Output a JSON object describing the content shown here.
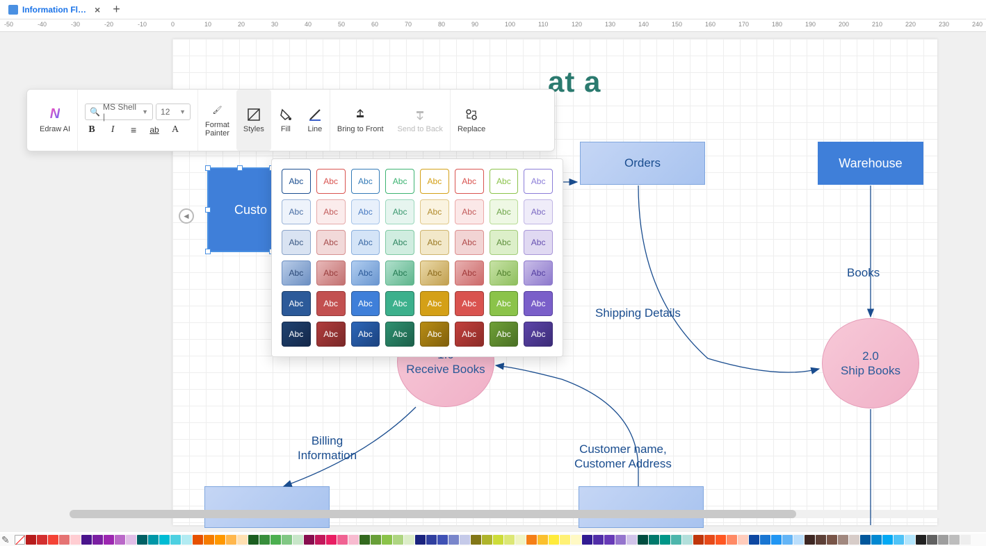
{
  "tab": {
    "title": "Information Fl…"
  },
  "ruler_ticks": [
    -50,
    -40,
    -30,
    -20,
    -10,
    0,
    10,
    20,
    30,
    40,
    50,
    60,
    70,
    80,
    90,
    100,
    110,
    120,
    130,
    140,
    150,
    160,
    170,
    180,
    190,
    200,
    210,
    220,
    230,
    240
  ],
  "toolbar": {
    "ai_label": "Edraw AI",
    "font_name": "MS Shell |",
    "font_size": "12",
    "format_painter": "Format\nPainter",
    "styles": "Styles",
    "fill": "Fill",
    "line": "Line",
    "bring_front": "Bring to Front",
    "send_back": "Send to Back",
    "replace": "Replace"
  },
  "style_swatches": [
    {
      "bg": "#ffffff",
      "bd": "#1a4d8f",
      "fg": "#1a4d8f"
    },
    {
      "bg": "#ffffff",
      "bd": "#d9534f",
      "fg": "#d9534f"
    },
    {
      "bg": "#ffffff",
      "bd": "#337ab7",
      "fg": "#337ab7"
    },
    {
      "bg": "#ffffff",
      "bd": "#3cb371",
      "fg": "#3cb371"
    },
    {
      "bg": "#ffffff",
      "bd": "#d4a017",
      "fg": "#d4a017"
    },
    {
      "bg": "#ffffff",
      "bd": "#d9534f",
      "fg": "#d9534f"
    },
    {
      "bg": "#ffffff",
      "bd": "#8bc34a",
      "fg": "#8bc34a"
    },
    {
      "bg": "#ffffff",
      "bd": "#8b7dd8",
      "fg": "#8b7dd8"
    },
    {
      "bg": "#eef3fb",
      "bd": "#9ab4d8",
      "fg": "#4a6fa5"
    },
    {
      "bg": "#fbecec",
      "bd": "#e5a9a9",
      "fg": "#c25b5b"
    },
    {
      "bg": "#e8f0fb",
      "bd": "#a5c3e8",
      "fg": "#4a7bc2"
    },
    {
      "bg": "#e6f5ef",
      "bd": "#9bd8bc",
      "fg": "#3c9970"
    },
    {
      "bg": "#faf3e0",
      "bd": "#e0c88a",
      "fg": "#b28c2e"
    },
    {
      "bg": "#fbe8e8",
      "bd": "#eba8a8",
      "fg": "#c25b5b"
    },
    {
      "bg": "#eef8e4",
      "bd": "#b8dc96",
      "fg": "#6fa54a"
    },
    {
      "bg": "#efecf9",
      "bd": "#c0b5e5",
      "fg": "#7a68c2"
    },
    {
      "bg": "#d9e3f2",
      "bd": "#8ba4c9",
      "fg": "#3c5a85"
    },
    {
      "bg": "#f2d9d9",
      "bd": "#d69090",
      "fg": "#a54a4a"
    },
    {
      "bg": "#d4e4f7",
      "bd": "#8cb0dd",
      "fg": "#3c6aa5"
    },
    {
      "bg": "#d0ede0",
      "bd": "#7fc9a3",
      "fg": "#2e8560"
    },
    {
      "bg": "#f2e8c9",
      "bd": "#cfb46e",
      "fg": "#9b7a25"
    },
    {
      "bg": "#f2d4d4",
      "bd": "#dc8f8f",
      "fg": "#b04a4a"
    },
    {
      "bg": "#dcefc9",
      "bd": "#a3cc7a",
      "fg": "#5e8f3c"
    },
    {
      "bg": "#e0d9f2",
      "bd": "#a896d8",
      "fg": "#6650b0"
    },
    {
      "bg": "#b8cce8",
      "bd": "#6c8fc2",
      "fg": "#2c4a78",
      "grad": true
    },
    {
      "bg": "#e8b8b8",
      "bd": "#c27070",
      "fg": "#993c3c",
      "grad": true
    },
    {
      "bg": "#b0cdf0",
      "bd": "#6a96d0",
      "fg": "#2c5a99",
      "grad": true
    },
    {
      "bg": "#b0e0cc",
      "bd": "#5eb58c",
      "fg": "#237a52",
      "grad": true
    },
    {
      "bg": "#ead9a8",
      "bd": "#c2a050",
      "fg": "#8c6a1c",
      "grad": true
    },
    {
      "bg": "#e8b0b0",
      "bd": "#cc6a6a",
      "fg": "#a03838",
      "grad": true
    },
    {
      "bg": "#c7e2a6",
      "bd": "#8fbf5e",
      "fg": "#4f7f2c",
      "grad": true
    },
    {
      "bg": "#c9bde8",
      "bd": "#8c78cc",
      "fg": "#523ca0",
      "grad": true
    },
    {
      "bg": "#2c5a99",
      "bd": "#1c3c66",
      "fg": "#ffffff"
    },
    {
      "bg": "#c25050",
      "bd": "#993838",
      "fg": "#ffffff"
    },
    {
      "bg": "#3f7fd9",
      "bd": "#2c5a99",
      "fg": "#ffffff"
    },
    {
      "bg": "#3cb08c",
      "bd": "#287a60",
      "fg": "#ffffff"
    },
    {
      "bg": "#d4a017",
      "bd": "#a07810",
      "fg": "#ffffff"
    },
    {
      "bg": "#d9534f",
      "bd": "#a03c38",
      "fg": "#ffffff"
    },
    {
      "bg": "#8bc34a",
      "bd": "#5e9030",
      "fg": "#ffffff"
    },
    {
      "bg": "#7a5fc9",
      "bd": "#5640a0",
      "fg": "#ffffff"
    },
    {
      "bg": "#1f4270",
      "bd": "#14284a",
      "fg": "#ffffff",
      "grad": true
    },
    {
      "bg": "#b03c3c",
      "bd": "#7a2828",
      "fg": "#ffffff",
      "grad": true
    },
    {
      "bg": "#2c66b8",
      "bd": "#1c4380",
      "fg": "#ffffff",
      "grad": true
    },
    {
      "bg": "#2e9070",
      "bd": "#1c604a",
      "fg": "#ffffff",
      "grad": true
    },
    {
      "bg": "#b88c14",
      "bd": "#80600c",
      "fg": "#ffffff",
      "grad": true
    },
    {
      "bg": "#c2403c",
      "bd": "#8c2c28",
      "fg": "#ffffff",
      "grad": true
    },
    {
      "bg": "#6fa038",
      "bd": "#4a7024",
      "fg": "#ffffff",
      "grad": true
    },
    {
      "bg": "#5c44a8",
      "bd": "#3c2c78",
      "fg": "#ffffff",
      "grad": true
    }
  ],
  "swatch_label": "Abc",
  "diagram": {
    "title_fragment": "at a",
    "title_color": "#2b7a6f",
    "customer": "Custo",
    "orders": "Orders",
    "warehouse": "Warehouse",
    "process1_num": "1.0",
    "process1": "Receive Books",
    "process2_num": "2.0",
    "process2": "Ship Books",
    "edge_shipping": "Shipping Details",
    "edge_books": "Books",
    "edge_billing1": "Billing",
    "edge_billing2": "Information",
    "edge_cust1": "Customer name,",
    "edge_cust2": "Customer Address"
  },
  "color_strip": [
    "#b71c1c",
    "#d32f2f",
    "#f44336",
    "#e57373",
    "#ffcdd2",
    "#4a148c",
    "#7b1fa2",
    "#9c27b0",
    "#ba68c8",
    "#e1bee7",
    "#006064",
    "#0097a7",
    "#00bcd4",
    "#4dd0e1",
    "#b2ebf2",
    "#e65100",
    "#f57c00",
    "#ff9800",
    "#ffb74d",
    "#ffe0b2",
    "#1b5e20",
    "#388e3c",
    "#4caf50",
    "#81c784",
    "#c8e6c9",
    "#880e4f",
    "#c2185b",
    "#e91e63",
    "#f06292",
    "#f8bbd0",
    "#33691e",
    "#689f38",
    "#8bc34a",
    "#aed581",
    "#dcedc8",
    "#1a237e",
    "#303f9f",
    "#3f51b5",
    "#7986cb",
    "#c5cae9",
    "#827717",
    "#afb42b",
    "#cddc39",
    "#dce775",
    "#f0f4c3",
    "#f57f17",
    "#fbc02d",
    "#ffeb3b",
    "#fff176",
    "#fff9c4",
    "#311b92",
    "#512da8",
    "#673ab7",
    "#9575cd",
    "#d1c4e9",
    "#004d40",
    "#00796b",
    "#009688",
    "#4db6ac",
    "#b2dfdb",
    "#bf360c",
    "#e64a19",
    "#ff5722",
    "#ff8a65",
    "#ffccbc",
    "#0d47a1",
    "#1976d2",
    "#2196f3",
    "#64b5f6",
    "#bbdefb",
    "#3e2723",
    "#5d4037",
    "#795548",
    "#a1887f",
    "#d7ccc8",
    "#01579b",
    "#0288d1",
    "#03a9f4",
    "#4fc3f7",
    "#b3e5fc",
    "#212121",
    "#616161",
    "#9e9e9e",
    "#bdbdbd",
    "#eeeeee"
  ]
}
